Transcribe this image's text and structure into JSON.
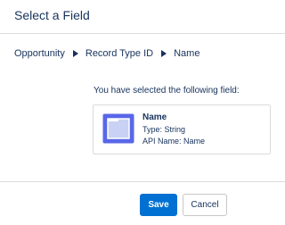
{
  "dialog": {
    "title": "Select a Field"
  },
  "breadcrumb": {
    "items": [
      "Opportunity",
      "Record Type ID",
      "Name"
    ]
  },
  "selection": {
    "prompt": "You have selected the following field:",
    "field_name": "Name",
    "field_type": "Type: String",
    "field_api_name": "API Name: Name",
    "icon": "string-field-icon",
    "icon_color": "#5867e8"
  },
  "footer": {
    "save_label": "Save",
    "cancel_label": "Cancel"
  },
  "colors": {
    "primary": "#0070d2",
    "text": "#16325c",
    "border": "#dddbda"
  }
}
